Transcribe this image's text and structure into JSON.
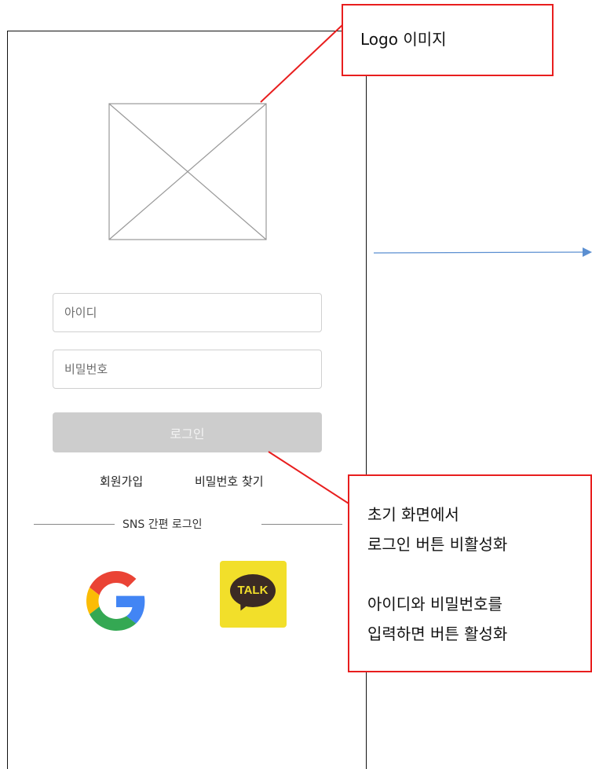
{
  "login_form": {
    "id_placeholder": "아이디",
    "pw_placeholder": "비밀번호",
    "login_label": "로그인",
    "signup_label": "회원가입",
    "find_pw_label": "비밀번호 찾기",
    "sns_title": "SNS 간편 로그인"
  },
  "sns": {
    "google_icon": "google-icon",
    "kakao_icon": "kakao-talk-icon",
    "kakao_text": "TALK"
  },
  "annotations": {
    "logo": "Logo  이미지",
    "login_lines": [
      "초기 화면에서",
      "로그인 버튼 비활성화",
      "",
      "아이디와   비밀번호를",
      "입력하면 버튼 활성화"
    ]
  },
  "colors": {
    "annotation": "#e81e1e",
    "login_disabled": "#cdcdcd",
    "kakao": "#f2df2a",
    "flow_arrow": "#5b8fd1"
  }
}
